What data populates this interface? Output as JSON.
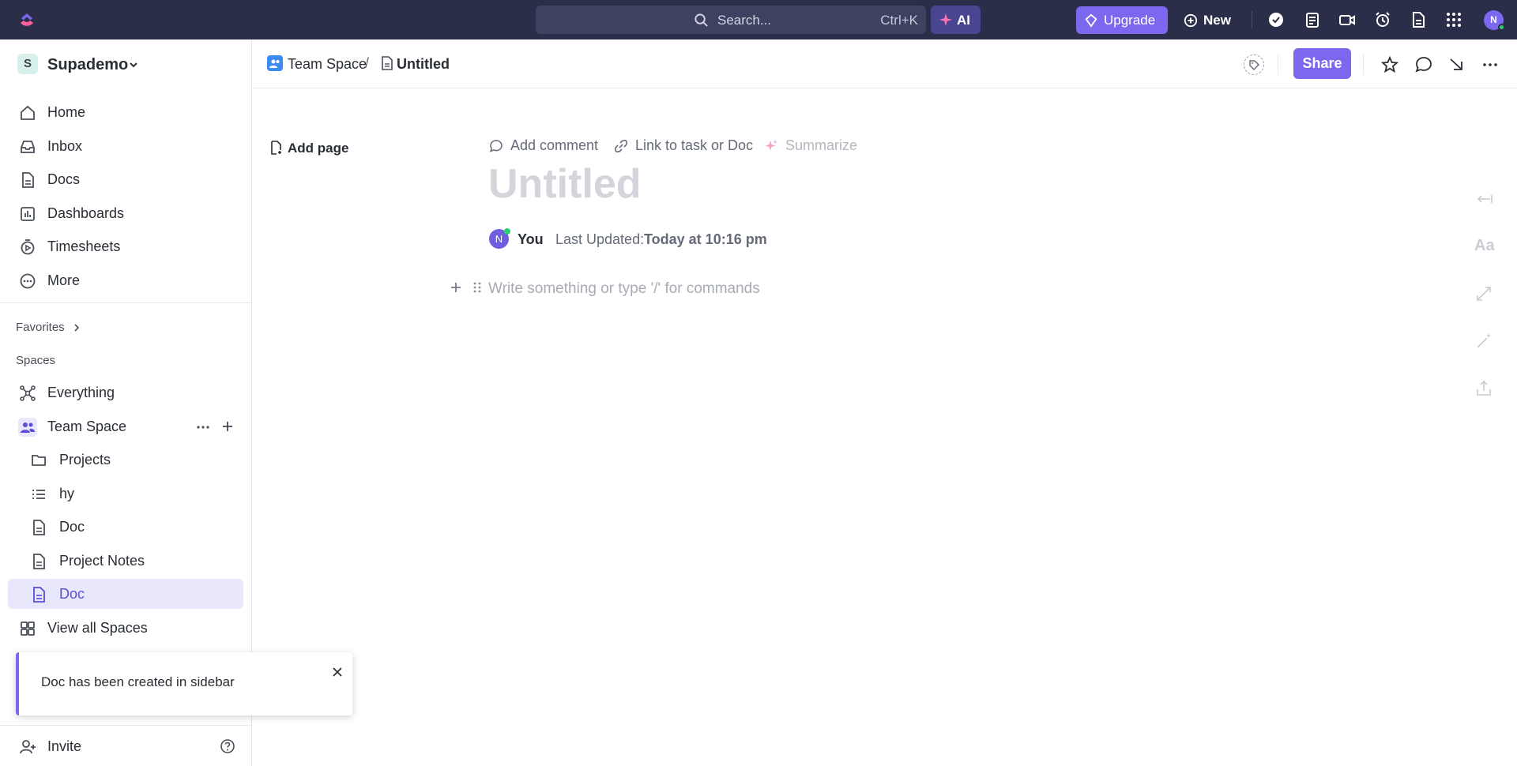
{
  "topbar": {
    "search_placeholder": "Search...",
    "search_shortcut": "Ctrl+K",
    "ai_label": "AI",
    "upgrade_label": "Upgrade",
    "new_label": "New",
    "avatar_initial": "N"
  },
  "sidebar": {
    "workspace_initial": "S",
    "workspace_name": "Supademo",
    "nav": [
      {
        "label": "Home",
        "icon": "home-icon"
      },
      {
        "label": "Inbox",
        "icon": "inbox-icon"
      },
      {
        "label": "Docs",
        "icon": "docs-icon"
      },
      {
        "label": "Dashboards",
        "icon": "dashboards-icon"
      },
      {
        "label": "Timesheets",
        "icon": "timesheets-icon"
      },
      {
        "label": "More",
        "icon": "more-icon"
      }
    ],
    "favorites_label": "Favorites",
    "spaces_label": "Spaces",
    "everything_label": "Everything",
    "team_space_label": "Team Space",
    "children": [
      {
        "label": "Projects",
        "icon": "folder-icon"
      },
      {
        "label": "hy",
        "icon": "list-icon"
      },
      {
        "label": "Doc",
        "icon": "doc-icon"
      },
      {
        "label": "Project Notes",
        "icon": "doc-icon"
      },
      {
        "label": "Doc",
        "icon": "doc-icon",
        "active": true
      }
    ],
    "view_all_label": "View all Spaces",
    "invite_label": "Invite"
  },
  "toast": {
    "message": "Doc has been created in sidebar"
  },
  "header": {
    "breadcrumb_space": "Team Space",
    "breadcrumb_sep": "/",
    "breadcrumb_doc": "Untitled",
    "share_label": "Share"
  },
  "doc": {
    "add_page_label": "Add page",
    "add_comment_label": "Add comment",
    "link_label": "Link to task or Doc",
    "summarize_label": "Summarize",
    "title_placeholder": "Untitled",
    "author_initial": "N",
    "author": "You",
    "last_updated_label": "Last Updated:",
    "last_updated_value": "Today at 10:16 pm",
    "editor_placeholder": "Write something or type '/' for commands"
  },
  "colors": {
    "topbar_bg": "#2a2e48",
    "accent": "#7b68ee",
    "active_bg": "#e9e7fb"
  }
}
